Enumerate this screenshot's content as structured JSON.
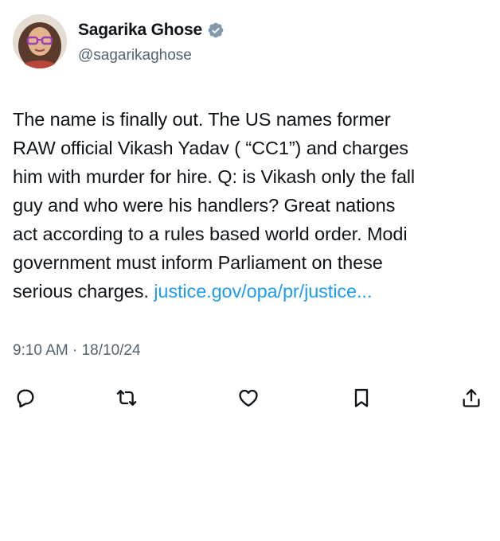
{
  "author": {
    "display_name": "Sagarika Ghose",
    "handle": "@sagarikaghose",
    "verified_badge_icon": "verified-badge-icon",
    "avatar": "profile-photo"
  },
  "tweet": {
    "lines": [
      "The name is finally out. The US names former",
      "RAW official Vikash Yadav ( “CC1”) and charges",
      "him with murder for hire. Q: is Vikash only the fall",
      "guy and who were his handlers? Great nations",
      "act according to a rules based world order. Modi",
      "government must inform Parliament on these"
    ],
    "last_line_text": "serious charges. ",
    "link_text": "justice.gov/opa/pr/justice...",
    "timestamp": "9:10 AM · 18/10/24"
  },
  "actions": [
    {
      "icon": "reply-icon"
    },
    {
      "icon": "retweet-icon"
    },
    {
      "icon": "like-icon"
    },
    {
      "icon": "bookmark-icon"
    },
    {
      "icon": "share-icon"
    }
  ],
  "colors": {
    "text": "#0f1419",
    "secondary": "#536471",
    "link": "#1d9bf0",
    "verified": "#829aab"
  }
}
